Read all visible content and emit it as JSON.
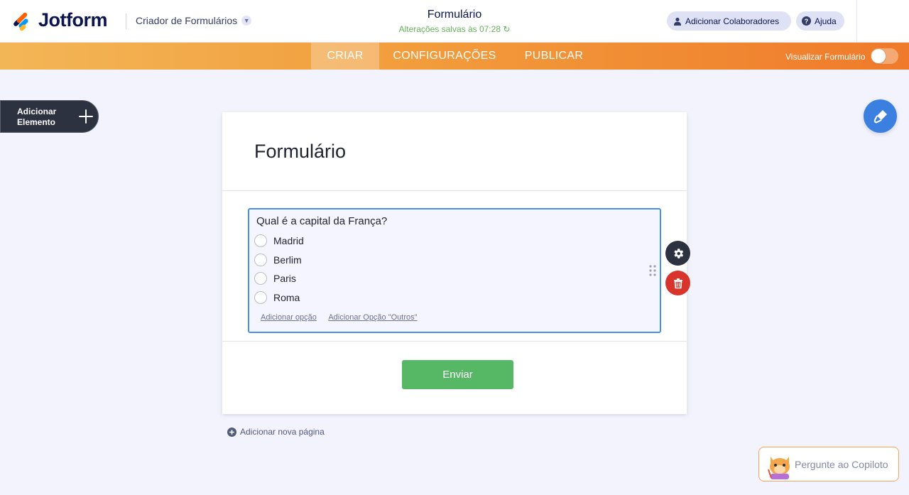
{
  "header": {
    "brand": "Jotform",
    "builder_label": "Criador de Formulários",
    "form_title": "Formulário",
    "saved_status": "Alterações salvas às 07:28",
    "collab_label": "Adicionar Colaboradores",
    "help_label": "Ajuda"
  },
  "nav": {
    "tabs": [
      {
        "label": "CRIAR",
        "active": true
      },
      {
        "label": "CONFIGURAÇÕES",
        "active": false
      },
      {
        "label": "PUBLICAR",
        "active": false
      }
    ],
    "preview_label": "Visualizar Formulário",
    "preview_on": false
  },
  "sidebar": {
    "add_element_line1": "Adicionar",
    "add_element_line2": "Elemento"
  },
  "form": {
    "heading": "Formulário",
    "question": {
      "label": "Qual é a capital da França?",
      "options": [
        "Madrid",
        "Berlim",
        "Paris",
        "Roma"
      ],
      "add_option": "Adicionar opção",
      "add_other": "Adicionar Opção \"Outros\""
    },
    "submit_label": "Enviar",
    "add_page_label": "Adicionar nova página"
  },
  "copilot": {
    "label": "Pergunte ao Copiloto"
  },
  "colors": {
    "accent_orange": "#ef7a2b",
    "primary_blue": "#3b80e0",
    "submit_green": "#56b765",
    "delete_red": "#d9342b",
    "saved_green": "#64b25a"
  }
}
